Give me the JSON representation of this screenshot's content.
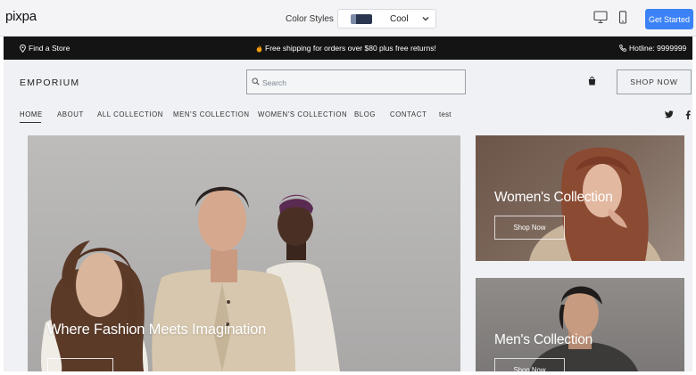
{
  "builder": {
    "logo": "pixpa",
    "color_styles_label": "Color Styles",
    "style_value": "Cool",
    "get_started": "Get Started"
  },
  "announce": {
    "find_store": "Find a Store",
    "shipping": "Free shipping for orders over $80 plus free returns!",
    "hotline": "Hotline: 9999999"
  },
  "header": {
    "brand": "EMPORIUM",
    "search_placeholder": "Search",
    "shop_now": "SHOP NOW"
  },
  "nav": {
    "items": [
      "HOME",
      "ABOUT",
      "ALL COLLECTION",
      "MEN'S COLLECTION",
      "WOMEN'S COLLECTION",
      "BLOG",
      "CONTACT",
      "test"
    ]
  },
  "hero": {
    "title": "Where Fashion Meets Imagination"
  },
  "cards": {
    "women": {
      "title": "Women's Collection",
      "button": "Shop Now"
    },
    "men": {
      "title": "Men's Collection",
      "button": "Shop Now"
    }
  },
  "colors": {
    "accent": "#3b82f6",
    "announce_bg": "#141414",
    "site_bg": "#eff1f4"
  }
}
